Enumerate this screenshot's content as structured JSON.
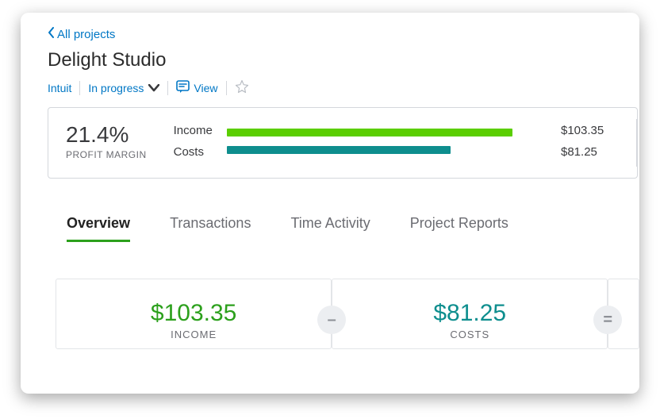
{
  "nav": {
    "back_label": "All projects"
  },
  "project": {
    "title": "Delight Studio",
    "company": "Intuit",
    "status": "In progress",
    "view_label": "View"
  },
  "summary": {
    "margin_pct": "21.4%",
    "margin_label": "PROFIT MARGIN",
    "income_label": "Income",
    "costs_label": "Costs",
    "income_value": "$103.35",
    "costs_value": "$81.25"
  },
  "tabs": {
    "overview": "Overview",
    "transactions": "Transactions",
    "time_activity": "Time Activity",
    "project_reports": "Project Reports"
  },
  "cards": {
    "income_amount": "$103.35",
    "income_label": "INCOME",
    "costs_amount": "$81.25",
    "costs_label": "COSTS",
    "minus": "–",
    "equals": "="
  },
  "chart_data": {
    "type": "bar",
    "categories": [
      "Income",
      "Costs"
    ],
    "values": [
      103.35,
      81.25
    ],
    "title": "",
    "xlabel": "",
    "ylabel": "",
    "ylim": [
      0,
      103.35
    ]
  }
}
